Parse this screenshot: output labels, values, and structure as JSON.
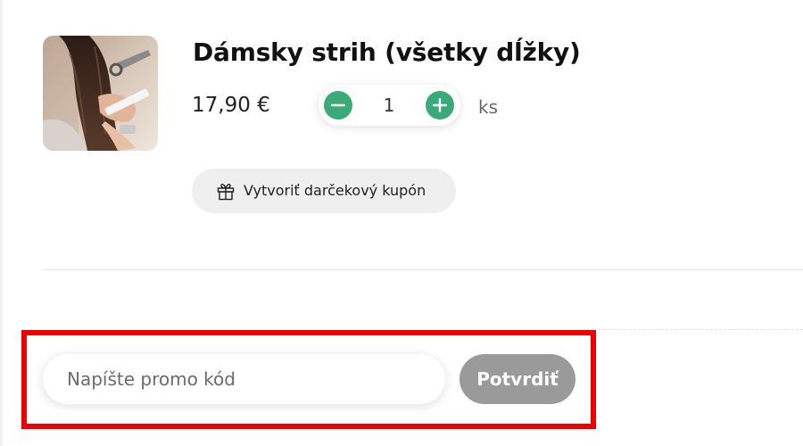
{
  "product": {
    "name": "Dámsky strih (všetky dĺžky)",
    "price": "17,90 €",
    "image": "haircut-photo"
  },
  "quantity": {
    "value": "1",
    "unit": "ks",
    "decrease_icon": "minus-icon",
    "increase_icon": "plus-icon"
  },
  "gift": {
    "label": "Vytvoriť darčekový kupón",
    "icon": "gift-icon"
  },
  "promo": {
    "placeholder": "Napíšte promo kód",
    "value": "",
    "button_label": "Potvrdiť"
  },
  "colors": {
    "accent_green": "#3aaa78",
    "confirm_button_gray": "#9a9a9a",
    "gift_button_bg": "#efefef",
    "highlight_red": "#ee0000"
  }
}
